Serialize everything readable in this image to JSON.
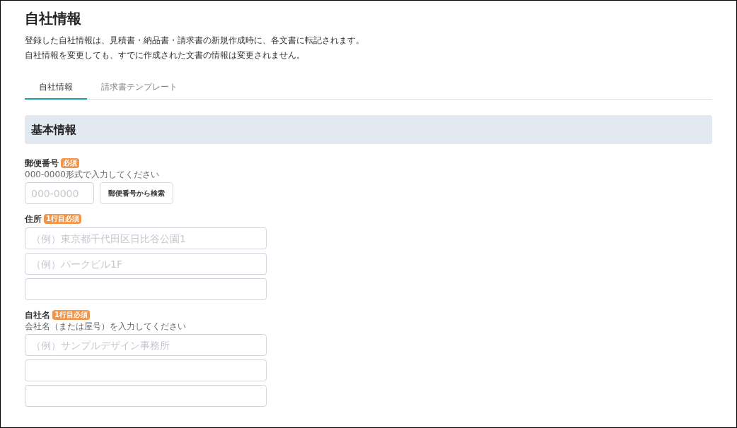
{
  "page": {
    "title": "自社情報",
    "description": [
      "登録した自社情報は、見積書・納品書・請求書の新規作成時に、各文書に転記されます。",
      "自社情報を変更しても、すでに作成された文書の情報は変更されません。"
    ]
  },
  "tabs": [
    {
      "label": "自社情報",
      "selected": true
    },
    {
      "label": "請求書テンプレート",
      "selected": false
    }
  ],
  "section": {
    "title": "基本情報"
  },
  "fields": [
    {
      "label": "郵便番号",
      "badge": "必須",
      "hint": "000-0000形式で入力してください",
      "kind": "postal",
      "inputs": [
        {
          "kind": "hinted",
          "placeholder": "000-0000"
        }
      ],
      "button": "郵便番号から検索"
    },
    {
      "label": "住所",
      "badge": "1行目必須",
      "kind": "lines",
      "inputs": [
        {
          "kind": "hinted",
          "placeholder": "（例）東京都千代田区日比谷公園1"
        },
        {
          "kind": "hinted",
          "placeholder": "（例）パークビル1F"
        },
        {
          "kind": "blank"
        }
      ]
    },
    {
      "label": "自社名",
      "badge": "1行目必須",
      "hint": "会社名（または屋号）を入力してください",
      "kind": "lines",
      "inputs": [
        {
          "kind": "hinted",
          "placeholder": "（例）サンプルデザイン事務所"
        },
        {
          "kind": "blank"
        },
        {
          "kind": "blank"
        }
      ]
    }
  ]
}
